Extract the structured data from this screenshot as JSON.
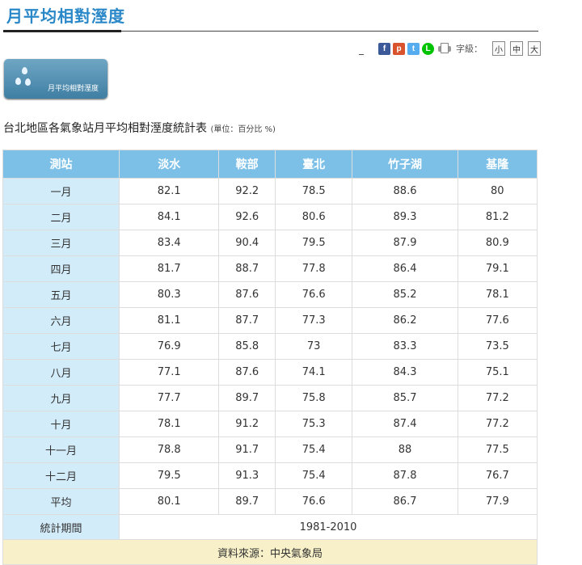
{
  "page": {
    "title": "月平均相對溼度"
  },
  "toolbar": {
    "dash": "_",
    "facebook": "f",
    "plurk": "p",
    "twitter": "t",
    "line": "L",
    "font_label": "字級：",
    "font_small": "小",
    "font_medium": "中",
    "font_large": "大"
  },
  "badge": {
    "text": "月平均相對溼度"
  },
  "caption": {
    "title": "台北地區各氣象站月平均相對溼度統計表",
    "unit": "(單位：百分比 %)"
  },
  "table": {
    "headers": [
      "測站",
      "淡水",
      "鞍部",
      "臺北",
      "竹子湖",
      "基隆"
    ],
    "rows": [
      [
        "一月",
        "82.1",
        "92.2",
        "78.5",
        "88.6",
        "80"
      ],
      [
        "二月",
        "84.1",
        "92.6",
        "80.6",
        "89.3",
        "81.2"
      ],
      [
        "三月",
        "83.4",
        "90.4",
        "79.5",
        "87.9",
        "80.9"
      ],
      [
        "四月",
        "81.7",
        "88.7",
        "77.8",
        "86.4",
        "79.1"
      ],
      [
        "五月",
        "80.3",
        "87.6",
        "76.6",
        "85.2",
        "78.1"
      ],
      [
        "六月",
        "81.1",
        "87.7",
        "77.3",
        "86.2",
        "77.6"
      ],
      [
        "七月",
        "76.9",
        "85.8",
        "73",
        "83.3",
        "73.5"
      ],
      [
        "八月",
        "77.1",
        "87.6",
        "74.1",
        "84.3",
        "75.1"
      ],
      [
        "九月",
        "77.7",
        "89.7",
        "75.8",
        "85.7",
        "77.2"
      ],
      [
        "十月",
        "78.1",
        "91.2",
        "75.3",
        "87.4",
        "77.2"
      ],
      [
        "十一月",
        "78.8",
        "91.7",
        "75.4",
        "88",
        "77.5"
      ],
      [
        "十二月",
        "79.5",
        "91.3",
        "75.4",
        "87.8",
        "76.7"
      ],
      [
        "平均",
        "80.1",
        "89.7",
        "76.6",
        "86.7",
        "77.9"
      ]
    ],
    "period_label": "統計期間",
    "period_value": "1981-2010",
    "source": "資料來源：中央氣象局"
  }
}
